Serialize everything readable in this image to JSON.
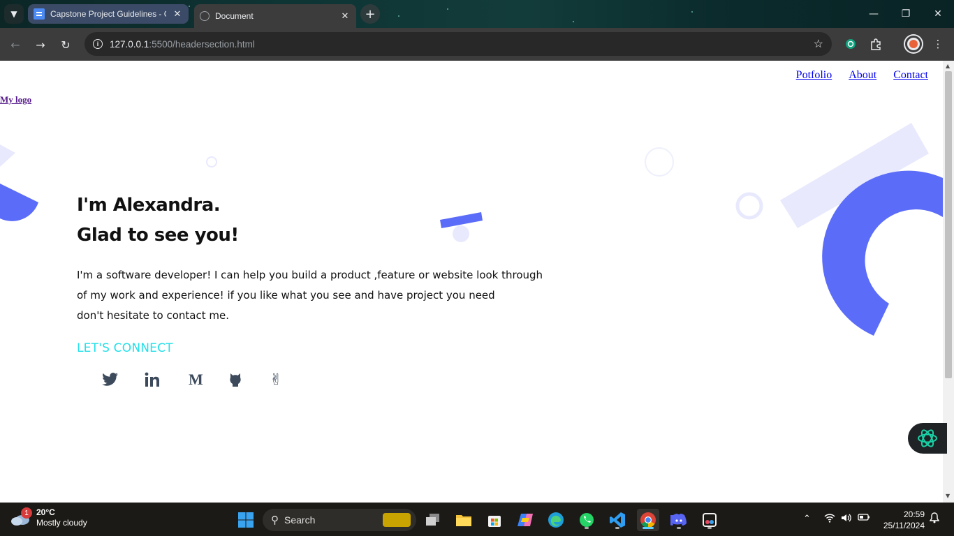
{
  "browser": {
    "tabs": [
      {
        "title": "Capstone Project Guidelines - G",
        "active": false
      },
      {
        "title": "Document",
        "active": true
      }
    ],
    "url_host": "127.0.0.1",
    "url_path": ":5500/headersection.html"
  },
  "page": {
    "nav": [
      "Potfolio",
      "About",
      "Contact"
    ],
    "logo": "My logo",
    "hero_line1": "I'm Alexandra.",
    "hero_line2": "Glad to see you!",
    "intro_line1": "I'm a software developer! I can help you build a product ,feature or website look through",
    "intro_line2": "of my work and experience! if you like what you see and have project you need",
    "intro_line3": "don't hesitate to contact me.",
    "connect_label": "LET'S CONNECT",
    "socials": [
      "twitter-icon",
      "linkedin-icon",
      "medium-icon",
      "github-icon",
      "angellist-icon"
    ],
    "colors": {
      "accent": "#22e0ea",
      "shape_blue": "#5b6cf9",
      "shape_light": "#e8e9fd"
    }
  },
  "taskbar": {
    "weather_badge": "1",
    "weather_temp": "20°C",
    "weather_desc": "Mostly cloudy",
    "search_placeholder": "Search",
    "time": "20:59",
    "date": "25/11/2024"
  }
}
